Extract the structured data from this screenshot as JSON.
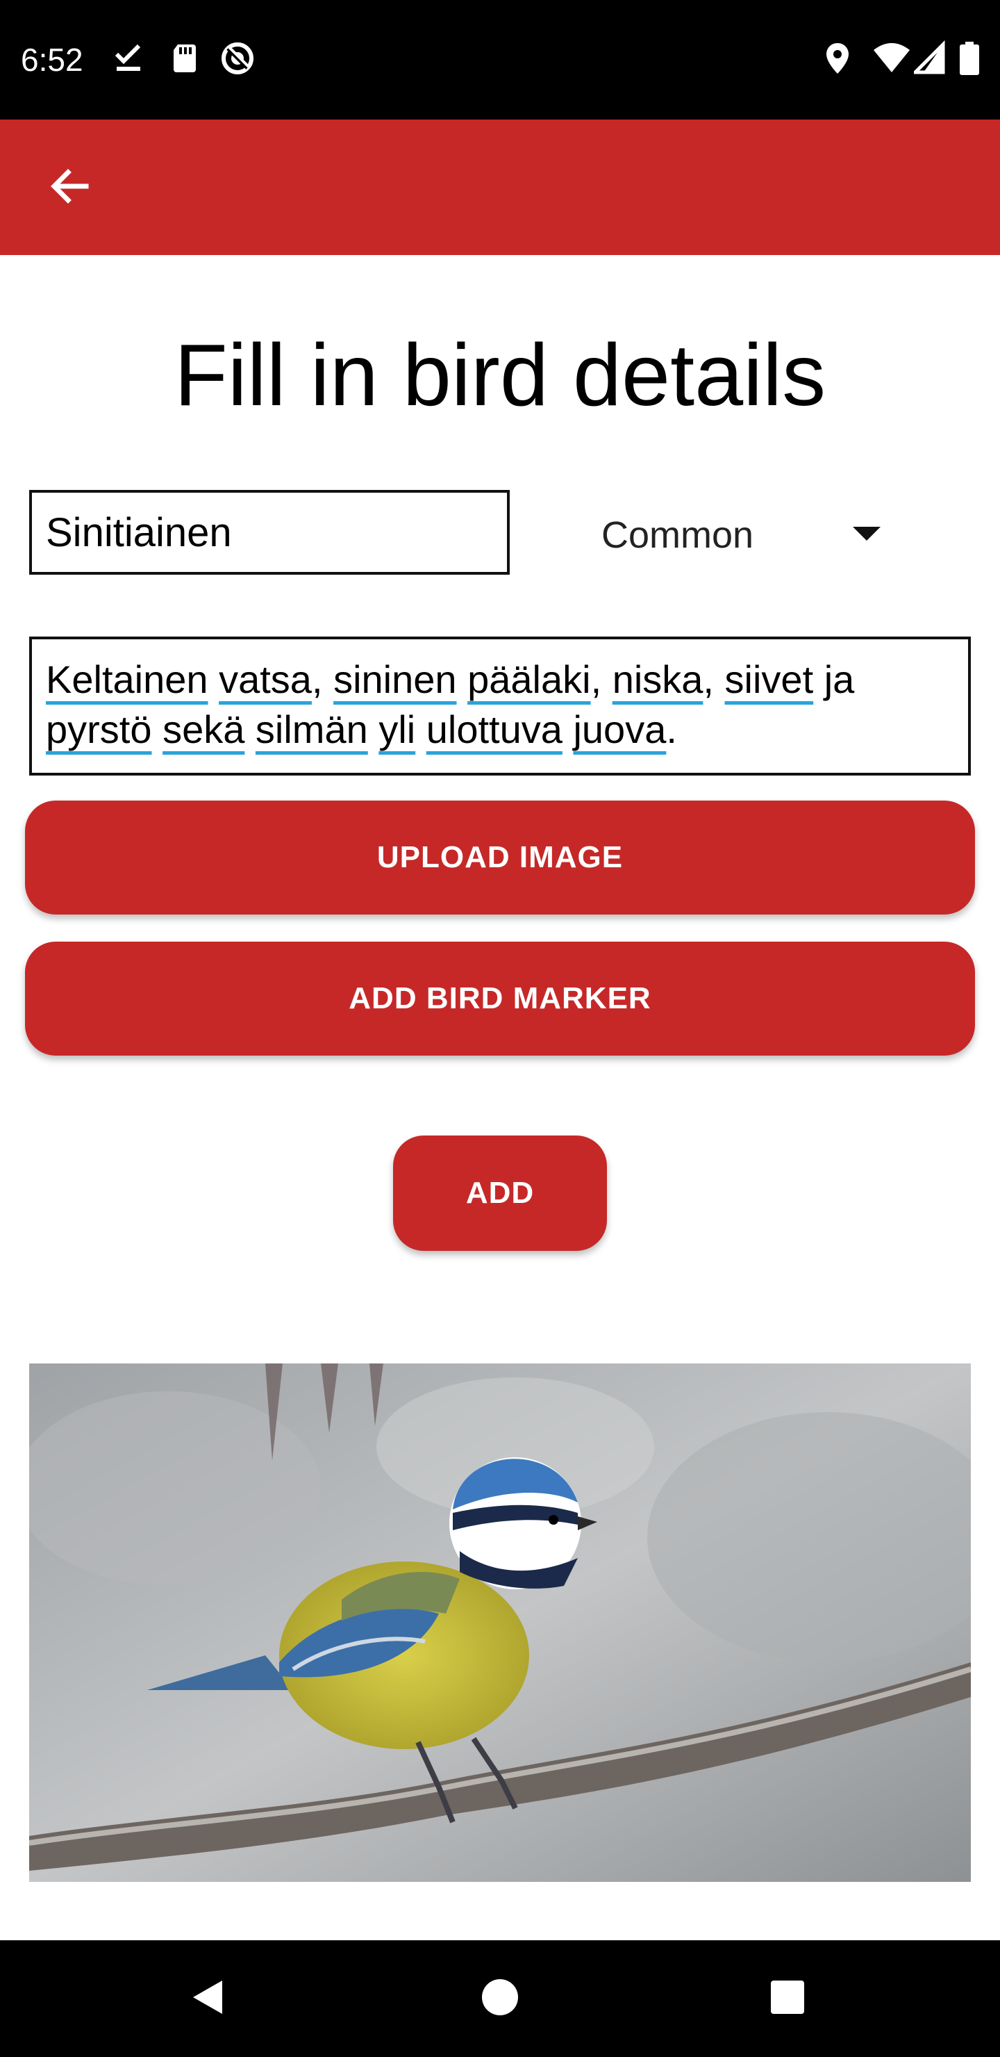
{
  "status_bar": {
    "time": "6:52",
    "left_icons": [
      "check-download-icon",
      "sd-card-icon",
      "no-disturb-icon"
    ],
    "right_icons": [
      "location-icon",
      "wifi-icon",
      "signal-icon",
      "battery-icon"
    ]
  },
  "app_bar": {
    "color": "#c62828",
    "back_icon": "arrow-back-icon"
  },
  "form": {
    "title": "Fill in bird details",
    "name_value": "Sinitiainen",
    "rarity_selected": "Common",
    "description_words": [
      "Keltainen",
      "vatsa",
      "sininen",
      "päälaki",
      "niska",
      "siivet",
      "ja",
      "pyrstö",
      "sekä",
      "silmän",
      "yli",
      "ulottuva",
      "juova"
    ]
  },
  "buttons": {
    "upload_image": "UPLOAD IMAGE",
    "add_bird_marker": "ADD BIRD MARKER",
    "add": "ADD"
  },
  "nav_bar": {
    "icons": [
      "nav-back-icon",
      "nav-home-icon",
      "nav-recents-icon"
    ]
  },
  "colors": {
    "accent": "#c62828",
    "spell_underline": "#29a3db"
  }
}
